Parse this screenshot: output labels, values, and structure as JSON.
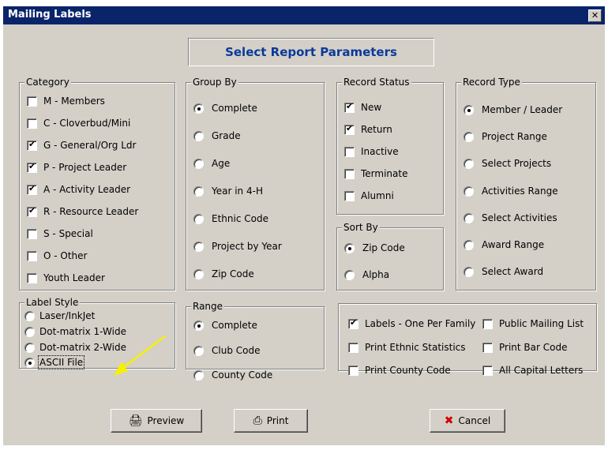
{
  "window": {
    "title": "Mailing Labels",
    "close_glyph": "✕"
  },
  "header": {
    "title": "Select Report Parameters"
  },
  "category": {
    "legend": "Category",
    "items": [
      {
        "label": "M - Members",
        "checked": false
      },
      {
        "label": "C - Cloverbud/Mini",
        "checked": false
      },
      {
        "label": "G - General/Org Ldr",
        "checked": true
      },
      {
        "label": "P - Project Leader",
        "checked": true
      },
      {
        "label": "A - Activity Leader",
        "checked": true
      },
      {
        "label": "R - Resource Leader",
        "checked": true
      },
      {
        "label": "S - Special",
        "checked": false
      },
      {
        "label": "O - Other",
        "checked": false
      },
      {
        "label": "Youth Leader",
        "checked": false
      }
    ]
  },
  "group_by": {
    "legend": "Group By",
    "items": [
      {
        "label": "Complete",
        "selected": true
      },
      {
        "label": "Grade",
        "selected": false
      },
      {
        "label": "Age",
        "selected": false
      },
      {
        "label": "Year in 4-H",
        "selected": false
      },
      {
        "label": "Ethnic Code",
        "selected": false
      },
      {
        "label": "Project by Year",
        "selected": false
      },
      {
        "label": "Zip Code",
        "selected": false
      }
    ]
  },
  "record_status": {
    "legend": "Record Status",
    "items": [
      {
        "label": "New",
        "checked": true
      },
      {
        "label": "Return",
        "checked": true
      },
      {
        "label": "Inactive",
        "checked": false
      },
      {
        "label": "Terminate",
        "checked": false
      },
      {
        "label": "Alumni",
        "checked": false
      }
    ]
  },
  "sort_by": {
    "legend": "Sort By",
    "items": [
      {
        "label": "Zip Code",
        "selected": true
      },
      {
        "label": "Alpha",
        "selected": false
      }
    ]
  },
  "record_type": {
    "legend": "Record Type",
    "items": [
      {
        "label": "Member / Leader",
        "selected": true
      },
      {
        "label": "Project Range",
        "selected": false
      },
      {
        "label": "Select Projects",
        "selected": false
      },
      {
        "label": "Activities Range",
        "selected": false
      },
      {
        "label": "Select Activities",
        "selected": false
      },
      {
        "label": "Award Range",
        "selected": false
      },
      {
        "label": "Select Award",
        "selected": false
      }
    ]
  },
  "label_style": {
    "legend": "Label Style",
    "items": [
      {
        "label": "Laser/InkJet",
        "selected": false
      },
      {
        "label": "Dot-matrix 1-Wide",
        "selected": false
      },
      {
        "label": "Dot-matrix 2-Wide",
        "selected": false
      },
      {
        "label": "ASCII File",
        "selected": true
      }
    ]
  },
  "range": {
    "legend": "Range",
    "items": [
      {
        "label": "Complete",
        "selected": true
      },
      {
        "label": "Club Code",
        "selected": false
      },
      {
        "label": "County Code",
        "selected": false
      }
    ]
  },
  "options": {
    "items": [
      {
        "label": "Labels - One Per Family",
        "checked": true
      },
      {
        "label": "Public Mailing List",
        "checked": false
      },
      {
        "label": "Print Ethnic Statistics",
        "checked": false
      },
      {
        "label": "Print Bar Code",
        "checked": false
      },
      {
        "label": "Print County Code",
        "checked": false
      },
      {
        "label": "All Capital Letters",
        "checked": false
      }
    ]
  },
  "buttons": {
    "preview": "Preview",
    "print": "Print",
    "cancel": "Cancel"
  },
  "icons": {
    "preview": "preview-icon",
    "print": "printer-icon",
    "cancel": "red-x-icon"
  },
  "annotation": {
    "arrow_color": "#f7f000"
  },
  "colors": {
    "titlebar": "#0a246a",
    "header_text": "#0a3a9a",
    "cancel_x": "#d40000"
  }
}
